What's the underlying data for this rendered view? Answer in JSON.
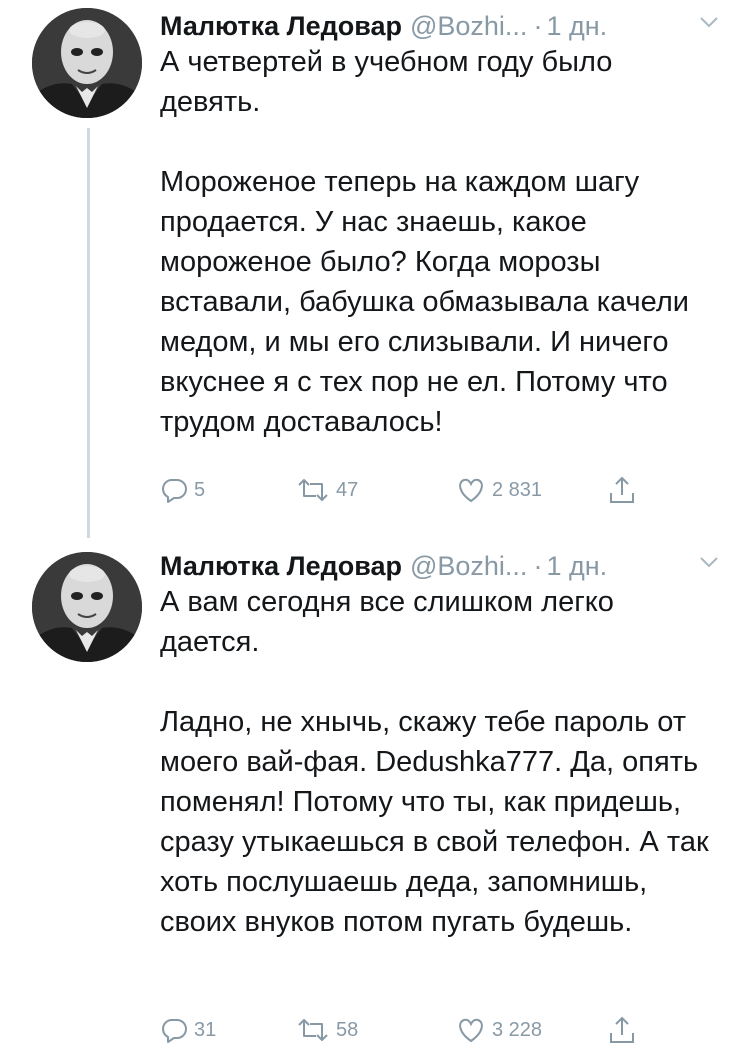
{
  "thread": [
    {
      "author_name": "Малютка Ледовар",
      "handle": "@Bozhi...",
      "separator": "·",
      "time": "1 дн.",
      "paragraphs": [
        "А четвертей в учебном году было девять.",
        "Мороженое теперь на каждом шагу продается. У нас знаешь, какое мороженое было? Когда морозы вставали, бабушка обмазывала качели медом, и мы его слизывали. И ничего вкуснее я с тех пор не ел. Потому что трудом доставалось!"
      ],
      "replies": "5",
      "retweets": "47",
      "likes": "2 831"
    },
    {
      "author_name": "Малютка Ледовар",
      "handle": "@Bozhi...",
      "separator": "·",
      "time": "1 дн.",
      "paragraphs": [
        "А вам сегодня все слишком легко дается.",
        "Ладно, не хнычь, скажу тебе пароль от моего вай-фая. Dedushka777. Да, опять поменял! Потому что ты, как придешь, сразу утыкаешься в свой телефон. А так хоть послушаешь деда, запомнишь, своих внуков потом пугать будешь."
      ],
      "replies": "31",
      "retweets": "58",
      "likes": "3 228"
    }
  ],
  "icons": {
    "reply": "reply-icon",
    "retweet": "retweet-icon",
    "like": "heart-icon",
    "share": "share-icon",
    "caret": "chevron-down-icon"
  },
  "colors": {
    "text": "#14171a",
    "secondary": "#8899a6",
    "thread_line": "#cfd9de"
  }
}
